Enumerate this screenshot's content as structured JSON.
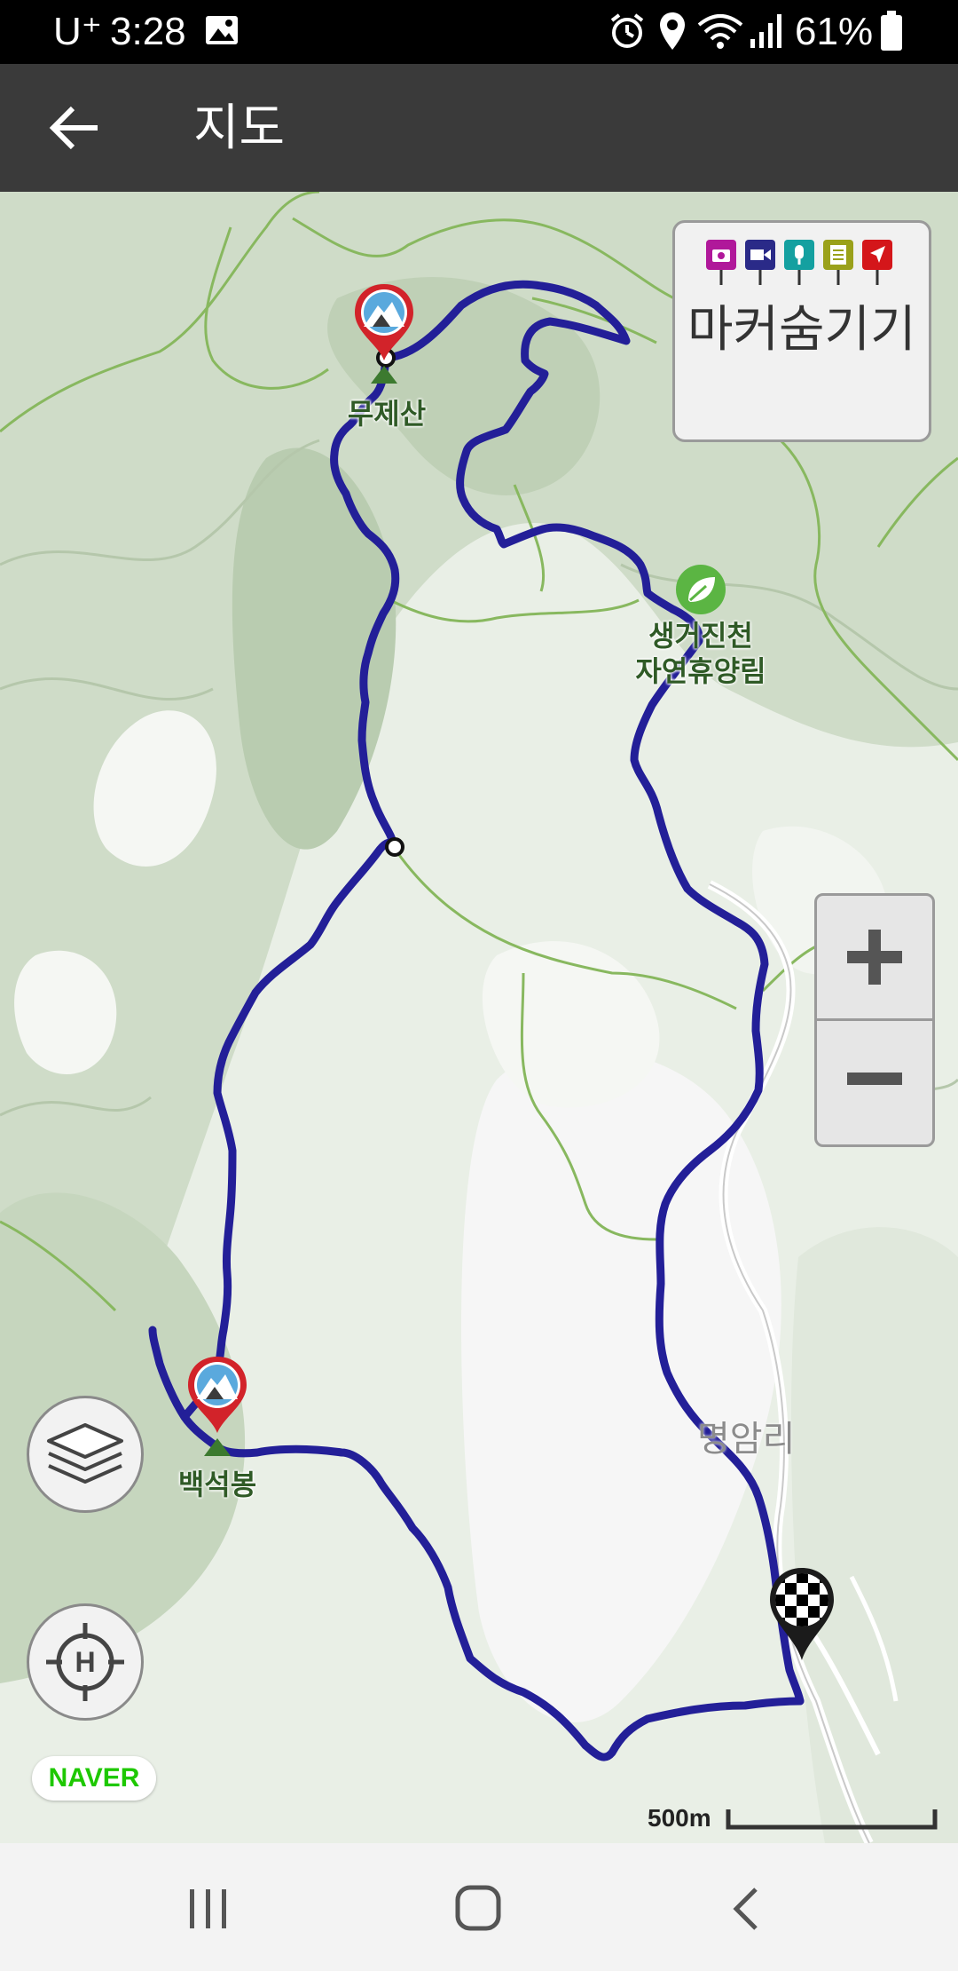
{
  "status_bar": {
    "carrier": "U⁺",
    "time": "3:28",
    "battery": "61%",
    "icons": [
      "image-icon",
      "alarm-icon",
      "location-icon",
      "wifi-icon",
      "signal-icon",
      "battery-icon"
    ]
  },
  "app_bar": {
    "back_icon": "arrow-left-icon",
    "title": "지도"
  },
  "map": {
    "place_labels": {
      "mujesan": "무제산",
      "baekseokbong": "백석봉",
      "forest_line1": "생거진천",
      "forest_line2": "자연휴양림",
      "village": "명암리"
    },
    "marker_panel": {
      "label": "마커숨기기",
      "marker_icons": [
        "camera-icon",
        "video-icon",
        "mic-icon",
        "memo-icon",
        "pointer-icon"
      ],
      "marker_colors": [
        "#b0189a",
        "#2a2a88",
        "#14a0a0",
        "#9aa11a",
        "#d4161a"
      ]
    },
    "zoom": {
      "in_icon": "plus-icon",
      "out_icon": "minus-icon"
    },
    "layers_icon": "layers-icon",
    "heliport_icon": "heliport-target-icon",
    "provider_badge": "NAVER",
    "scale_label": "500m",
    "track_color": "#231f98"
  },
  "nav_bar": {
    "icons": [
      "recent-apps-icon",
      "home-icon",
      "back-icon"
    ]
  }
}
